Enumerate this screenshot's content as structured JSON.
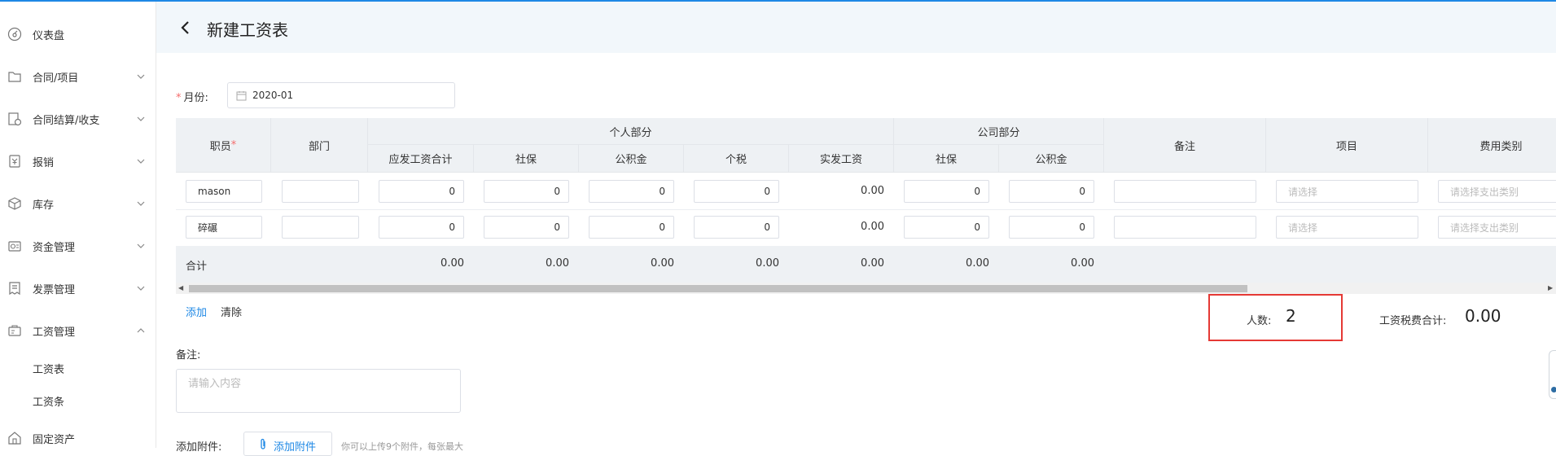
{
  "sidebar": {
    "items": [
      {
        "label": "仪表盘",
        "icon": "dashboard-icon"
      },
      {
        "label": "合同/项目",
        "icon": "folder-icon"
      },
      {
        "label": "合同结算/收支",
        "icon": "settlement-icon"
      },
      {
        "label": "报销",
        "icon": "reimburse-icon"
      },
      {
        "label": "库存",
        "icon": "box-icon"
      },
      {
        "label": "资金管理",
        "icon": "wallet-icon"
      },
      {
        "label": "发票管理",
        "icon": "invoice-icon"
      },
      {
        "label": "工资管理",
        "icon": "payroll-icon"
      },
      {
        "label": "固定资产",
        "icon": "asset-icon"
      }
    ],
    "payroll_sub": [
      "工资表",
      "工资条"
    ]
  },
  "header": {
    "title": "新建工资表"
  },
  "form": {
    "month_label": "月份:",
    "month_value": "2020-01",
    "note_label": "备注:",
    "note_placeholder": "请输入内容",
    "attach_label": "添加附件:",
    "attach_button": "添加附件",
    "attach_hint": "你可以上传9个附件，每张最大"
  },
  "table": {
    "headers": {
      "employee": "职员",
      "required_mark": "*",
      "dept": "部门",
      "personal_group": "个人部分",
      "company_group": "公司部分",
      "gross": "应发工资合计",
      "p_social": "社保",
      "p_fund": "公积金",
      "p_tax": "个税",
      "net": "实发工资",
      "c_social": "社保",
      "c_fund": "公积金",
      "remark": "备注",
      "project": "项目",
      "expense": "费用类别"
    },
    "rows": [
      {
        "employee": "mason",
        "dept": "",
        "gross": "0",
        "p_social": "0",
        "p_fund": "0",
        "p_tax": "0",
        "net": "0.00",
        "c_social": "0",
        "c_fund": "0",
        "remark": "",
        "project_placeholder": "请选择",
        "expense_placeholder": "请选择支出类别"
      },
      {
        "employee": "碎碾",
        "dept": "",
        "gross": "0",
        "p_social": "0",
        "p_fund": "0",
        "p_tax": "0",
        "net": "0.00",
        "c_social": "0",
        "c_fund": "0",
        "remark": "",
        "project_placeholder": "请选择",
        "expense_placeholder": "请选择支出类别"
      }
    ],
    "total": {
      "label": "合计",
      "gross": "0.00",
      "p_social": "0.00",
      "p_fund": "0.00",
      "p_tax": "0.00",
      "net": "0.00",
      "c_social": "0.00",
      "c_fund": "0.00"
    }
  },
  "actions": {
    "add": "添加",
    "clear": "清除"
  },
  "summary": {
    "count_label": "人数:",
    "count_value": "2",
    "tax_label": "工资税费合计:",
    "tax_value": "0.00"
  },
  "colors": {
    "accent": "#1e88e5",
    "highlight": "#e53935",
    "required": "#f56c6c",
    "header_bg": "#f2f7fb"
  }
}
